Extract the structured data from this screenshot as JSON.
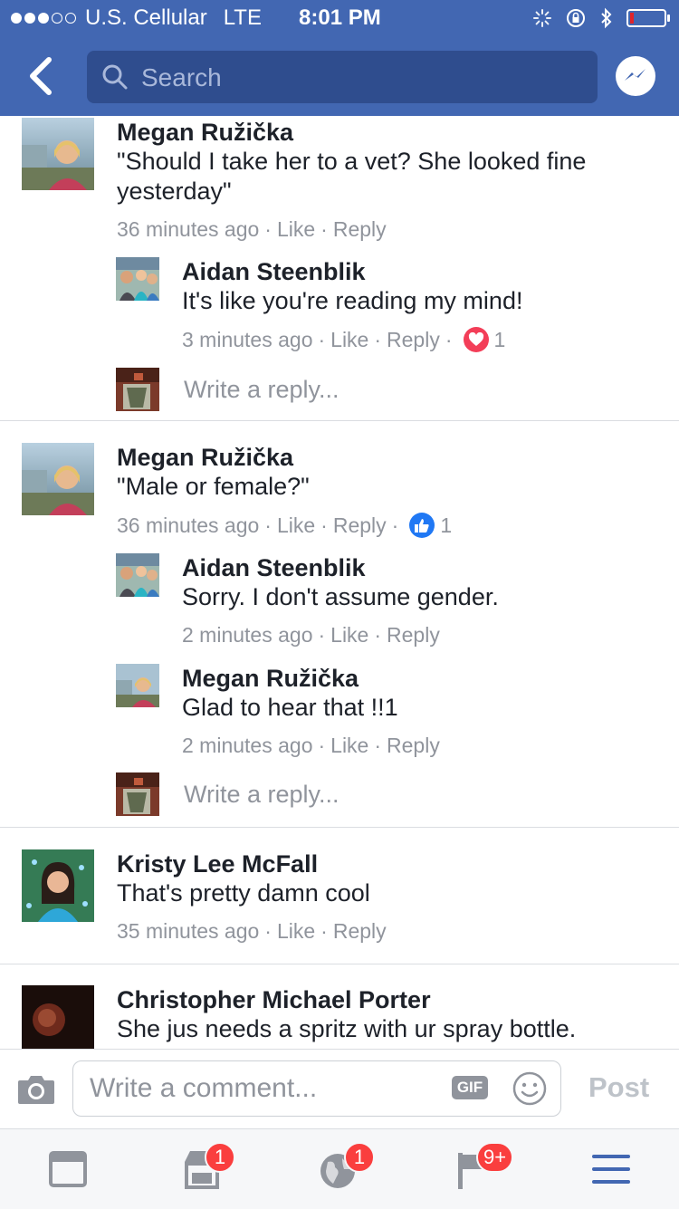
{
  "status_bar": {
    "carrier": "U.S. Cellular",
    "network": "LTE",
    "time": "8:01 PM",
    "signal_bars_filled": 3,
    "signal_bars_total": 5,
    "battery_level": 0.1
  },
  "nav": {
    "search_placeholder": "Search"
  },
  "comments": [
    {
      "author": "Megan Ružička",
      "text": "\"Should I take her to a vet? She looked fine yesterday\"",
      "time": "36 minutes ago",
      "like": "Like",
      "reply": "Reply",
      "replies": [
        {
          "author": "Aidan Steenblik",
          "text": "It's like you're reading my mind!",
          "time": "3 minutes ago",
          "like": "Like",
          "reply": "Reply",
          "reaction": {
            "type": "love",
            "count": "1",
            "color": "#f33e58"
          }
        }
      ],
      "write_reply_placeholder": "Write a reply..."
    },
    {
      "author": "Megan Ružička",
      "text": "\"Male or female?\"",
      "time": "36 minutes ago",
      "like": "Like",
      "reply": "Reply",
      "reaction": {
        "type": "like",
        "count": "1",
        "color": "#2078f4"
      },
      "replies": [
        {
          "author": "Aidan Steenblik",
          "text": "Sorry. I don't assume gender.",
          "time": "2 minutes ago",
          "like": "Like",
          "reply": "Reply"
        },
        {
          "author": "Megan Ružička",
          "text": "Glad to hear that !!1",
          "time": "2 minutes ago",
          "like": "Like",
          "reply": "Reply"
        }
      ],
      "write_reply_placeholder": "Write a reply..."
    },
    {
      "author": "Kristy Lee McFall",
      "text": "That's pretty damn cool",
      "time": "35 minutes ago",
      "like": "Like",
      "reply": "Reply"
    },
    {
      "author": "Christopher Michael Porter",
      "text": "She jus needs a spritz with ur spray bottle."
    }
  ],
  "composer": {
    "placeholder": "Write a comment...",
    "gif_label": "GIF",
    "post_label": "Post"
  },
  "tab_bar": {
    "tabs": [
      {
        "icon": "news-feed-icon",
        "badge": ""
      },
      {
        "icon": "marketplace-icon",
        "badge": "1"
      },
      {
        "icon": "notifications-globe-icon",
        "badge": "1"
      },
      {
        "icon": "flag-icon",
        "badge": "9+"
      },
      {
        "icon": "menu-icon",
        "badge": ""
      }
    ],
    "accent_color": "#4267b2",
    "badge_color": "#fa3e3e"
  },
  "colors": {
    "brand_blue": "#4267b2",
    "meta_gray": "#90949c",
    "text_dark": "#1d2129"
  }
}
